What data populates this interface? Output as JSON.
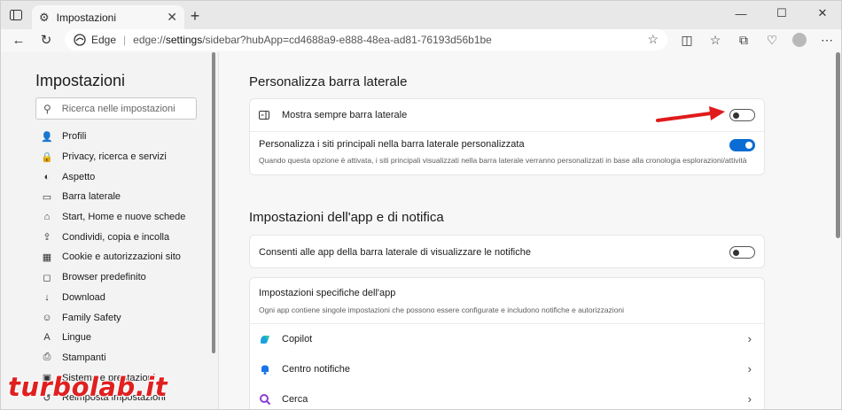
{
  "tab": {
    "title": "Impostazioni",
    "close": "✕"
  },
  "window": {
    "minimize": "—",
    "maximize": "☐",
    "close": "✕",
    "new_tab": "+"
  },
  "address": {
    "brand": "Edge",
    "url_prefix": "edge://",
    "url_path": "settings",
    "url_rest": "/sidebar?hubApp=cd4688a9-e888-48ea-ad81-76193d56b1be"
  },
  "sidebar": {
    "title": "Impostazioni",
    "search_placeholder": "Ricerca nelle impostazioni",
    "items": [
      {
        "label": "Profili",
        "icon": "👤"
      },
      {
        "label": "Privacy, ricerca e servizi",
        "icon": "🔒"
      },
      {
        "label": "Aspetto",
        "icon": "◐"
      },
      {
        "label": "Barra laterale",
        "icon": "▭"
      },
      {
        "label": "Start, Home e nuove schede",
        "icon": "⌂"
      },
      {
        "label": "Condividi, copia e incolla",
        "icon": "⇪"
      },
      {
        "label": "Cookie e autorizzazioni sito",
        "icon": "▦"
      },
      {
        "label": "Browser predefinito",
        "icon": "◻"
      },
      {
        "label": "Download",
        "icon": "↓"
      },
      {
        "label": "Family Safety",
        "icon": "☺"
      },
      {
        "label": "Lingue",
        "icon": "A"
      },
      {
        "label": "Stampanti",
        "icon": "⎙"
      },
      {
        "label": "Sistema e prestazioni",
        "icon": "▣"
      },
      {
        "label": "Reimposta impostazioni",
        "icon": "↺"
      }
    ]
  },
  "section1": {
    "heading": "Personalizza barra laterale",
    "always_show_label": "Mostra sempre barra laterale",
    "always_show_on": false,
    "personalize_label": "Personalizza i siti principali nella barra laterale personalizzata",
    "personalize_desc": "Quando questa opzione è attivata, i siti principali visualizzati nella barra laterale verranno personalizzati in base alla cronologia esplorazioni/attività",
    "personalize_on": true
  },
  "section2": {
    "heading": "Impostazioni dell'app e di notifica",
    "notify_label": "Consenti alle app della barra laterale di visualizzare le notifiche",
    "notify_on": false,
    "app_settings_title": "Impostazioni specifiche dell'app",
    "app_settings_desc": "Ogni app contiene singole impostazioni che possono essere configurate e includono notifiche e autorizzazioni",
    "apps": [
      {
        "label": "Copilot",
        "icon": "copilot-icon"
      },
      {
        "label": "Centro notifiche",
        "icon": "bell-icon"
      },
      {
        "label": "Cerca",
        "icon": "search-icon"
      }
    ]
  },
  "watermark": "turbolab.it"
}
